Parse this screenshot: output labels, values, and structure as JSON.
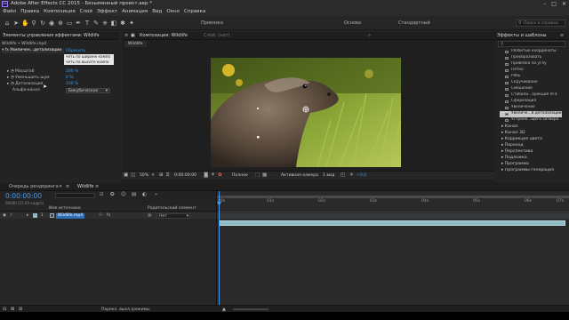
{
  "window": {
    "title": "Adobe After Effects CC 2015 - Безымянный проект.aep *",
    "logo": "Ae"
  },
  "menu": [
    "Файл",
    "Правка",
    "Композиция",
    "Слой",
    "Эффект",
    "Анимация",
    "Вид",
    "Окно",
    "Справка"
  ],
  "toolbar": {
    "workspaces": [
      {
        "label": "Привязка",
        "active": false
      },
      {
        "label": "Основа",
        "active": false
      },
      {
        "label": "Стандартный",
        "active": false
      }
    ],
    "help_placeholder": "Поиск в справке"
  },
  "effect_controls": {
    "tab_label": "Элементы управления эффектами: Wildlife",
    "layer_path": "Wildlife • Wildlife.mp4",
    "effect_name": "Увеличен...детализации",
    "reset_label": "Сбросить",
    "context_menu": [
      "четь по ширине компо",
      "четь по высоте компо"
    ],
    "properties": [
      {
        "label": "Масштаб",
        "value": "200 %"
      },
      {
        "label": "Уменьшить шум",
        "value": "0 %"
      },
      {
        "label": "Детализация",
        "value": "100 %"
      },
      {
        "label": "Альфа-канал",
        "value": "Бикубическое"
      }
    ]
  },
  "composition": {
    "tab_label": "Композиция: Wildlife",
    "tab_secondary": "Слой: (нет)",
    "breadcrumb": "Wildlife",
    "zoom": "50%",
    "timecode": "0:00:00:00",
    "resolution": "Полное",
    "camera": "Активная камера",
    "views": "1 вид",
    "exposure": "+0,0"
  },
  "effects_panel": {
    "title": "Эффекты и шаблоны",
    "items": [
      {
        "label": "Разбитые координаты",
        "selected": false
      },
      {
        "label": "Преобразовать",
        "selected": false
      },
      {
        "label": "Привязка по углу",
        "selected": false
      },
      {
        "label": "Пятно",
        "selected": false
      },
      {
        "label": "Рябь",
        "selected": false
      },
      {
        "label": "Скручивание",
        "selected": false
      },
      {
        "label": "Смещение",
        "selected": false
      },
      {
        "label": "Стабили...орекция VFX",
        "selected": false
      },
      {
        "label": "Сферизация",
        "selected": false
      },
      {
        "label": "Увеличение",
        "selected": false
      },
      {
        "label": "Увеличе...й детализации",
        "selected": true
      },
      {
        "label": "Устране...щего затвора",
        "selected": false
      }
    ],
    "categories": [
      "Канал",
      "Канал 3D",
      "Коррекция цвета",
      "Переход",
      "Перспектива",
      "Подложка",
      "Программа",
      "Программы-генерация"
    ]
  },
  "timeline": {
    "tab_render": "Очередь рендеринга",
    "tab_comp": "Wildlife",
    "timecode": "0:00:00:00",
    "frame_info": "00000 (25.00 кадр/с)",
    "col_source": "Имя источника",
    "col_parent": "Родительский элемент",
    "layer_index": "1",
    "layer_name": "Wildlife.mp4",
    "parent_value": "Нет",
    "ruler": [
      "00s",
      "01s",
      "02s",
      "03s",
      "04s",
      "05s",
      "06s",
      "07s"
    ],
    "bottom_label": "Перекл. выкл./режимы"
  },
  "colors": {
    "accent": "#3a9bf0",
    "layer_bar": "#8fbcc4",
    "panel": "#232323"
  }
}
